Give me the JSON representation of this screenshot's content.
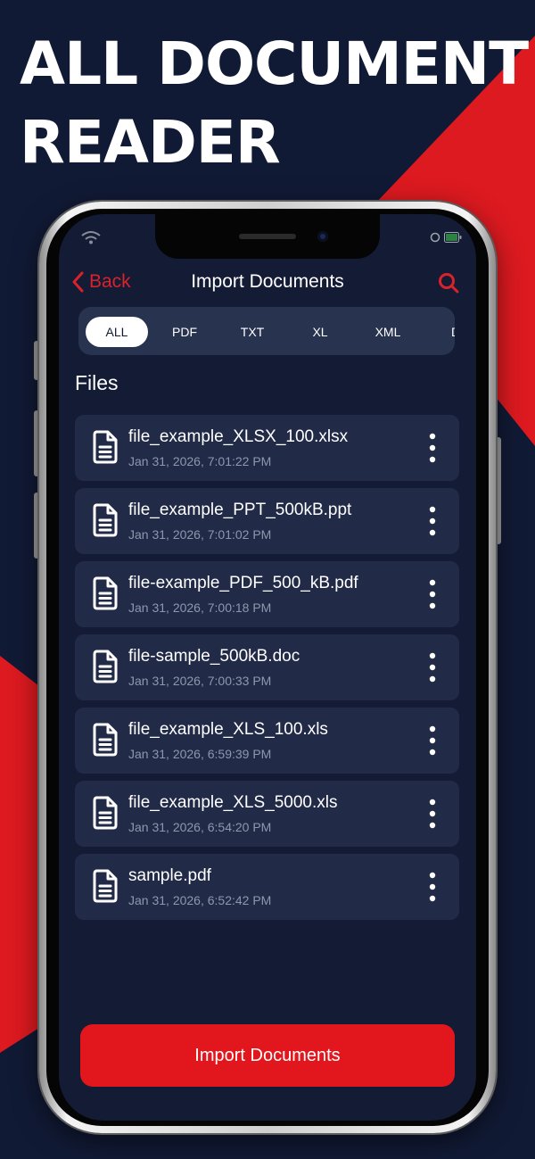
{
  "promo": {
    "line1": "ALL DOCUMENT",
    "line2": "READER"
  },
  "colors": {
    "background": "#111a35",
    "accent_red": "#e2161d",
    "card": "#212a47",
    "tab_bar": "#283350"
  },
  "nav": {
    "back_label": "Back",
    "back_icon": "chevron-left-icon",
    "title": "Import Documents",
    "search_icon": "search-icon"
  },
  "tabs": [
    {
      "label": "ALL",
      "active": true
    },
    {
      "label": "PDF",
      "active": false
    },
    {
      "label": "TXT",
      "active": false
    },
    {
      "label": "XL",
      "active": false
    },
    {
      "label": "XML",
      "active": false
    },
    {
      "label": "D",
      "active": false
    }
  ],
  "section_title": "Files",
  "files": [
    {
      "name": "file_example_XLSX_100.xlsx",
      "date": "Jan 31, 2026, 7:01:22 PM"
    },
    {
      "name": "file_example_PPT_500kB.ppt",
      "date": "Jan 31, 2026, 7:01:02 PM"
    },
    {
      "name": "file-example_PDF_500_kB.pdf",
      "date": "Jan 31, 2026, 7:00:18 PM"
    },
    {
      "name": "file-sample_500kB.doc",
      "date": "Jan 31, 2026, 7:00:33 PM"
    },
    {
      "name": "file_example_XLS_100.xls",
      "date": "Jan 31, 2026, 6:59:39 PM"
    },
    {
      "name": "file_example_XLS_5000.xls",
      "date": "Jan 31, 2026, 6:54:20 PM"
    },
    {
      "name": "sample.pdf",
      "date": "Jan 31, 2026, 6:52:42 PM"
    }
  ],
  "import_button_label": "Import Documents"
}
